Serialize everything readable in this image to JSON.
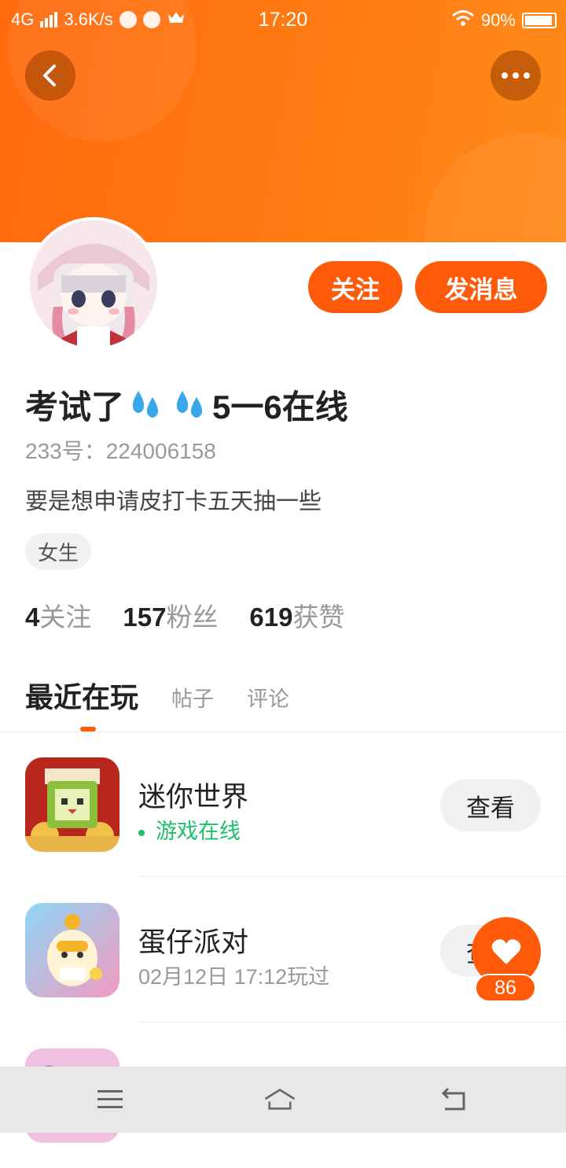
{
  "status_bar": {
    "network": "4G",
    "speed": "3.6K/s",
    "time": "17:20",
    "battery": "90%"
  },
  "header": {
    "back_icon": "chevron-left-icon",
    "more_icon": "more-dots-icon"
  },
  "profile": {
    "nickname_prefix": "考试了",
    "nickname_suffix": "5一6在线",
    "uid": "233号：224006158",
    "bio": "要是想申请皮打卡五天抽一些",
    "gender_tag": "女生",
    "follow_button": "关注",
    "message_button": "发消息"
  },
  "stats": [
    {
      "num": "4",
      "label": "关注"
    },
    {
      "num": "157",
      "label": "粉丝"
    },
    {
      "num": "619",
      "label": "获赞"
    }
  ],
  "tabs": {
    "active": "最近在玩",
    "posts": "帖子",
    "comments": "评论"
  },
  "games": [
    {
      "name": "迷你世界",
      "status": "游戏在线",
      "action": "查看"
    },
    {
      "name": "蛋仔派对",
      "status": "02月12日 17:12玩过",
      "action": "查看"
    }
  ],
  "like_fab": {
    "count": "86"
  },
  "colors": {
    "accent": "#ff5a0a",
    "online": "#1cbf6a"
  }
}
